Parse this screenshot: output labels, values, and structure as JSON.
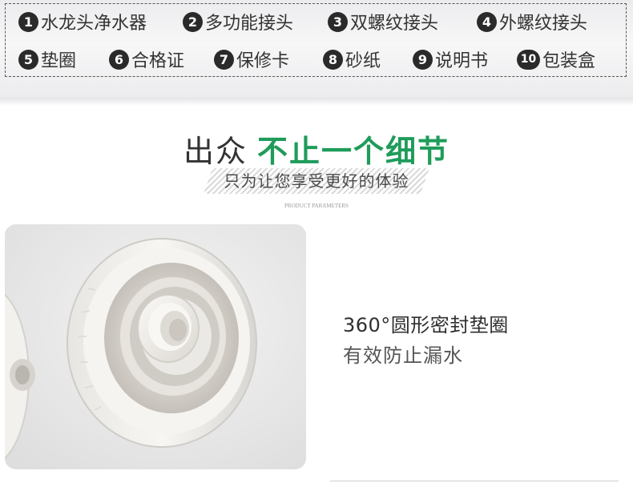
{
  "package_list": [
    {
      "num": "1",
      "label": "水龙头净水器"
    },
    {
      "num": "2",
      "label": "多功能接头"
    },
    {
      "num": "3",
      "label": "双螺纹接头"
    },
    {
      "num": "4",
      "label": "外螺纹接头"
    },
    {
      "num": "5",
      "label": "垫圈"
    },
    {
      "num": "6",
      "label": "合格证"
    },
    {
      "num": "7",
      "label": "保修卡"
    },
    {
      "num": "8",
      "label": "砂纸"
    },
    {
      "num": "9",
      "label": "说明书"
    },
    {
      "num": "10",
      "label": "包装盒"
    }
  ],
  "heading": {
    "part1": "出众",
    "part2": "不止一个细节",
    "subtitle": "只为让您享受更好的体验",
    "caption": "PRODUCT PARAMETERS"
  },
  "feature": {
    "title": "360°圆形密封垫圈",
    "description": "有效防止漏水"
  },
  "colors": {
    "accent_green": "#1f9c5a",
    "number_badge": "#2a2a2a"
  }
}
